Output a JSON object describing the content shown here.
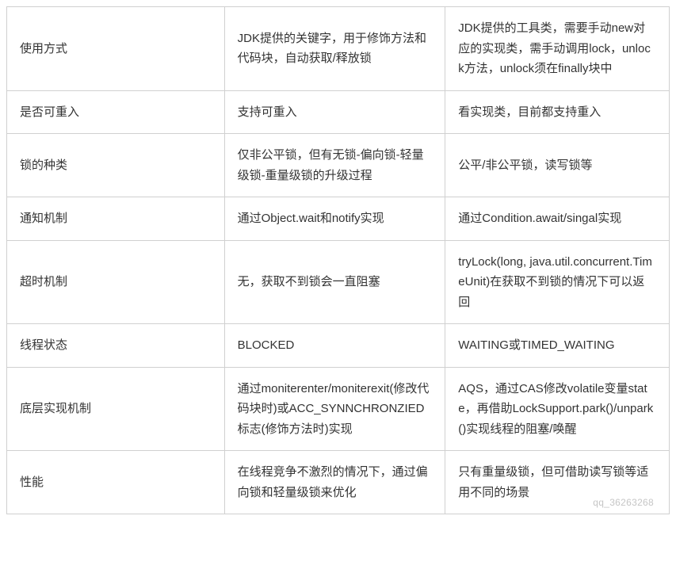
{
  "table": {
    "rows": [
      {
        "label": "使用方式",
        "col2": "JDK提供的关键字，用于修饰方法和代码块，自动获取/释放锁",
        "col3": "JDK提供的工具类，需要手动new对应的实现类，需手动调用lock，unlock方法，unlock须在finally块中"
      },
      {
        "label": "是否可重入",
        "col2": "支持可重入",
        "col3": "看实现类，目前都支持重入"
      },
      {
        "label": "锁的种类",
        "col2": "仅非公平锁，但有无锁-偏向锁-轻量级锁-重量级锁的升级过程",
        "col3": "公平/非公平锁，读写锁等"
      },
      {
        "label": "通知机制",
        "col2": "通过Object.wait和notify实现",
        "col3": "通过Condition.await/singal实现"
      },
      {
        "label": "超时机制",
        "col2": "无，获取不到锁会一直阻塞",
        "col3": "tryLock(long, java.util.concurrent.TimeUnit)在获取不到锁的情况下可以返回"
      },
      {
        "label": "线程状态",
        "col2": "BLOCKED",
        "col3": "WAITING或TIMED_WAITING"
      },
      {
        "label": "底层实现机制",
        "col2": "通过moniterenter/moniterexit(修改代码块时)或ACC_SYNNCHRONZIED标志(修饰方法时)实现",
        "col3": "AQS，通过CAS修改volatile变量state，再借助LockSupport.park()/unpark()实现线程的阻塞/唤醒"
      },
      {
        "label": "性能",
        "col2": "在线程竞争不激烈的情况下，通过偏向锁和轻量级锁来优化",
        "col3": "只有重量级锁，但可借助读写锁等适用不同的场景"
      }
    ]
  },
  "watermark": "qq_36263268"
}
